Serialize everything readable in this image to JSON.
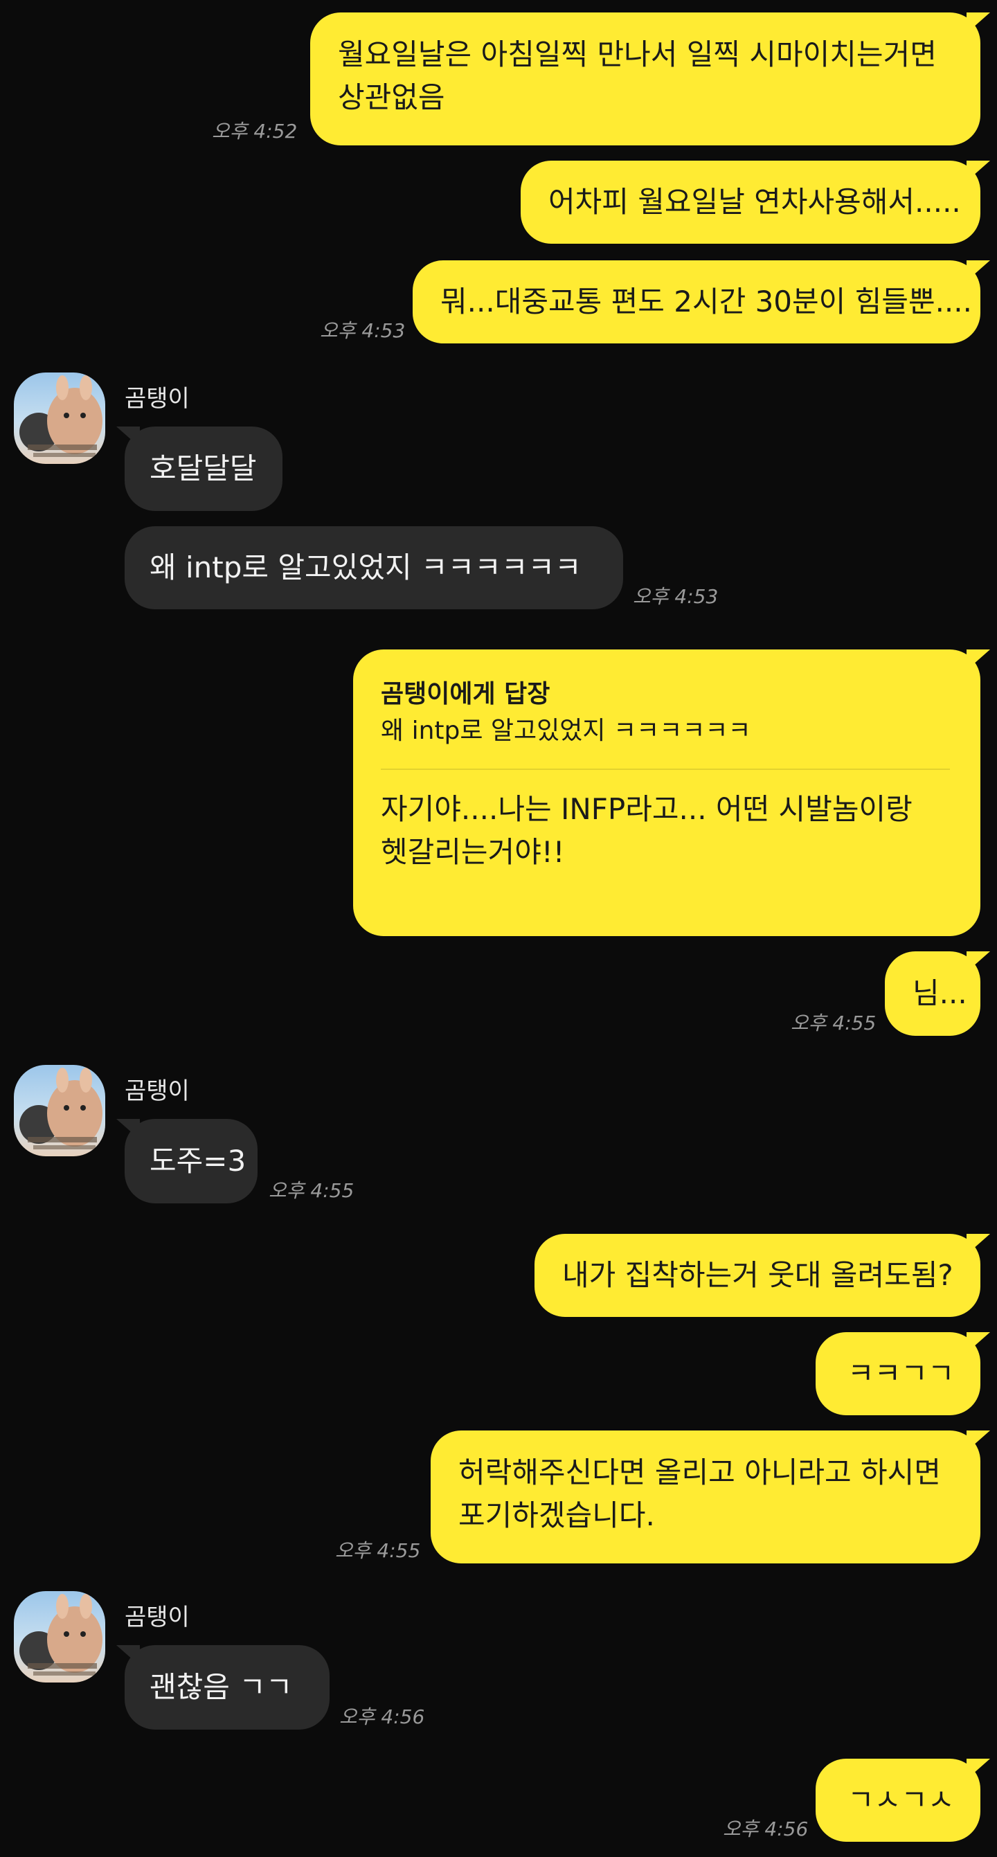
{
  "contact": {
    "name": "곰탱이"
  },
  "messages": {
    "m1": {
      "text_line1": "월요일날은 아침일찍 만나서 일찍 시마이치는거면",
      "text_line2": "상관없음",
      "time": "오후 4:52"
    },
    "m2": {
      "text": "어차피 월요일날 연차사용해서....."
    },
    "m3": {
      "text": "뭐...대중교통 편도 2시간 30분이 힘들뿐....",
      "time": "오후 4:53"
    },
    "m4": {
      "text": "호달달달"
    },
    "m5": {
      "text": "왜 intp로 알고있었지 ㅋㅋㅋㅋㅋㅋ",
      "time": "오후 4:53"
    },
    "m6": {
      "reply_title": "곰탱이에게 답장",
      "reply_quote": "왜 intp로 알고있었지 ㅋㅋㅋㅋㅋㅋ",
      "text_line1": "자기야....나는 INFP라고...  어떤 시발놈이랑",
      "text_line2": "헷갈리는거야!!"
    },
    "m7": {
      "text": "님...",
      "time": "오후 4:55"
    },
    "m8": {
      "text": "도주=3",
      "time": "오후 4:55"
    },
    "m9": {
      "text": "내가 집착하는거 웃대 올려도됨?"
    },
    "m10": {
      "text": "ㅋㅋㄱㄱ"
    },
    "m11": {
      "text_line1": "허락해주신다면 올리고 아니라고 하시면",
      "text_line2": "포기하겠습니다.",
      "time": "오후 4:55"
    },
    "m12": {
      "text": "괜찮음 ㄱㄱ",
      "time": "오후 4:56"
    },
    "m13": {
      "text": "ㄱㅅㄱㅅ",
      "time": "오후 4:56"
    }
  },
  "colors": {
    "background": "#0b0b0b",
    "my_bubble": "#ffeb33",
    "their_bubble": "#2a2a2a",
    "timestamp": "#9a9a9a"
  },
  "icons": {
    "avatar": "bear-rabbit-profile-image"
  }
}
